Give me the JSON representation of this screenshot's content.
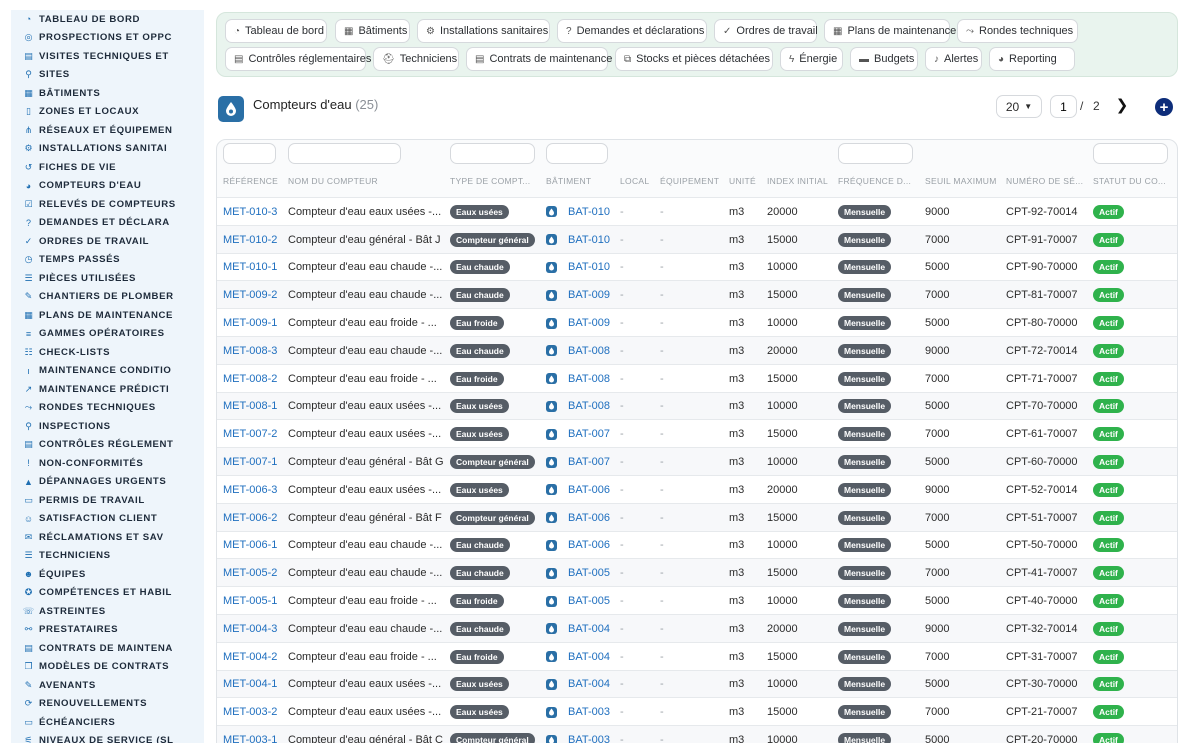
{
  "sidebar": {
    "items": [
      {
        "label": "TABLEAU DE BORD",
        "icon": "dashboard-icon"
      },
      {
        "label": "PROSPECTIONS ET OPPC",
        "icon": "target-icon"
      },
      {
        "label": "VISITES TECHNIQUES ET",
        "icon": "clipboard-icon"
      },
      {
        "label": "SITES",
        "icon": "map-pin-icon"
      },
      {
        "label": "BÂTIMENTS",
        "icon": "building-icon"
      },
      {
        "label": "ZONES ET LOCAUX",
        "icon": "door-icon"
      },
      {
        "label": "RÉSEAUX ET ÉQUIPEMEN",
        "icon": "network-icon"
      },
      {
        "label": "INSTALLATIONS SANITAI",
        "icon": "gears-icon"
      },
      {
        "label": "FICHES DE VIE",
        "icon": "history-icon"
      },
      {
        "label": "COMPTEURS D'EAU",
        "icon": "gauge-icon"
      },
      {
        "label": "RELEVÉS DE COMPTEURS",
        "icon": "check-square-icon"
      },
      {
        "label": "DEMANDES ET DÉCLARA",
        "icon": "question-icon"
      },
      {
        "label": "ORDRES DE TRAVAIL",
        "icon": "clipboard-check-icon"
      },
      {
        "label": "TEMPS PASSÉS",
        "icon": "clock-icon"
      },
      {
        "label": "PIÈCES UTILISÉES",
        "icon": "list-icon"
      },
      {
        "label": "CHANTIERS DE PLOMBER",
        "icon": "wrench-icon"
      },
      {
        "label": "PLANS DE MAINTENANCE",
        "icon": "calendar-icon"
      },
      {
        "label": "GAMMES OPÉRATOIRES",
        "icon": "layers-icon"
      },
      {
        "label": "CHECK-LISTS",
        "icon": "checklist-icon"
      },
      {
        "label": "MAINTENANCE CONDITIO",
        "icon": "thermometer-icon"
      },
      {
        "label": "MAINTENANCE PRÉDICTI",
        "icon": "chart-icon"
      },
      {
        "label": "RONDES TECHNIQUES",
        "icon": "route-icon"
      },
      {
        "label": "INSPECTIONS",
        "icon": "magnifier-icon"
      },
      {
        "label": "CONTRÔLES RÉGLEMENT",
        "icon": "clipboard-list-icon"
      },
      {
        "label": "NON-CONFORMITÉS",
        "icon": "alert-circle-icon"
      },
      {
        "label": "DÉPANNAGES URGENTS",
        "icon": "warning-triangle-icon"
      },
      {
        "label": "PERMIS DE TRAVAIL",
        "icon": "file-icon"
      },
      {
        "label": "SATISFACTION CLIENT",
        "icon": "smile-icon"
      },
      {
        "label": "RÉCLAMATIONS ET SAV",
        "icon": "comment-icon"
      },
      {
        "label": "TECHNICIENS",
        "icon": "list-icon"
      },
      {
        "label": "ÉQUIPES",
        "icon": "users-icon"
      },
      {
        "label": "COMPÉTENCES ET HABIL",
        "icon": "certificate-icon"
      },
      {
        "label": "ASTREINTES",
        "icon": "phone-icon"
      },
      {
        "label": "PRESTATAIRES",
        "icon": "handshake-icon"
      },
      {
        "label": "CONTRATS DE MAINTENA",
        "icon": "file-contract-icon"
      },
      {
        "label": "MODÈLES DE CONTRATS",
        "icon": "copy-icon"
      },
      {
        "label": "AVENANTS",
        "icon": "edit-icon"
      },
      {
        "label": "RENOUVELLEMENTS",
        "icon": "refresh-icon"
      },
      {
        "label": "ÉCHÉANCIERS",
        "icon": "file-alt-icon"
      },
      {
        "label": "NIVEAUX DE SERVICE (SL",
        "icon": "sliders-icon"
      }
    ]
  },
  "topnav": {
    "row1": [
      {
        "label": "Tableau de bord",
        "icon": "dashboard-icon"
      },
      {
        "label": "Bâtiments",
        "icon": "building-icon"
      },
      {
        "label": "Installations sanitaires",
        "icon": "gears-icon"
      },
      {
        "label": "Demandes et déclarations",
        "icon": "question-icon"
      },
      {
        "label": "Ordres de travail",
        "icon": "clipboard-check-icon"
      },
      {
        "label": "Plans de maintenance",
        "icon": "calendar-icon"
      },
      {
        "label": "Rondes techniques",
        "icon": "route-icon"
      }
    ],
    "row2": [
      {
        "label": "Contrôles réglementaires",
        "icon": "clipboard-list-icon"
      },
      {
        "label": "Techniciens",
        "icon": "hard-hat-icon"
      },
      {
        "label": "Contrats de maintenance",
        "icon": "file-contract-icon"
      },
      {
        "label": "Stocks et pièces détachées",
        "icon": "boxes-icon"
      },
      {
        "label": "Énergie",
        "icon": "bolt-icon"
      },
      {
        "label": "Budgets",
        "icon": "money-icon"
      },
      {
        "label": "Alertes",
        "icon": "bell-icon"
      },
      {
        "label": "Reporting",
        "icon": "pie-chart-icon"
      }
    ]
  },
  "header": {
    "title": "Compteurs d'eau",
    "count": "(25)"
  },
  "pagination": {
    "per_page": "20",
    "current_page": "1",
    "separator": "/",
    "total_pages": "2"
  },
  "table": {
    "columns": [
      "RÉFÉRENCE",
      "NOM DU COMPTEUR",
      "TYPE DE COMPT...",
      "BÂTIMENT",
      "LOCAL",
      "ÉQUIPEMENT",
      "UNITÉ",
      "INDEX INITIAL",
      "FRÉQUENCE D...",
      "SEUIL MAXIMUM",
      "NUMÉRO DE SÉ...",
      "STATUT DU CO..."
    ],
    "rows": [
      {
        "ref": "MET-010-3",
        "name": "Compteur d'eau eaux usées -...",
        "type": "Eaux usées",
        "bat": "BAT-010",
        "local": "-",
        "equip": "-",
        "unit": "m3",
        "index": "20000",
        "freq": "Mensuelle",
        "seuil": "9000",
        "serial": "CPT-92-70014",
        "status": "Actif"
      },
      {
        "ref": "MET-010-2",
        "name": "Compteur d'eau général - Bât J",
        "type": "Compteur général",
        "bat": "BAT-010",
        "local": "-",
        "equip": "-",
        "unit": "m3",
        "index": "15000",
        "freq": "Mensuelle",
        "seuil": "7000",
        "serial": "CPT-91-70007",
        "status": "Actif"
      },
      {
        "ref": "MET-010-1",
        "name": "Compteur d'eau eau chaude -...",
        "type": "Eau chaude",
        "bat": "BAT-010",
        "local": "-",
        "equip": "-",
        "unit": "m3",
        "index": "10000",
        "freq": "Mensuelle",
        "seuil": "5000",
        "serial": "CPT-90-70000",
        "status": "Actif"
      },
      {
        "ref": "MET-009-2",
        "name": "Compteur d'eau eau chaude -...",
        "type": "Eau chaude",
        "bat": "BAT-009",
        "local": "-",
        "equip": "-",
        "unit": "m3",
        "index": "15000",
        "freq": "Mensuelle",
        "seuil": "7000",
        "serial": "CPT-81-70007",
        "status": "Actif"
      },
      {
        "ref": "MET-009-1",
        "name": "Compteur d'eau eau froide - ...",
        "type": "Eau froide",
        "bat": "BAT-009",
        "local": "-",
        "equip": "-",
        "unit": "m3",
        "index": "10000",
        "freq": "Mensuelle",
        "seuil": "5000",
        "serial": "CPT-80-70000",
        "status": "Actif"
      },
      {
        "ref": "MET-008-3",
        "name": "Compteur d'eau eau chaude -...",
        "type": "Eau chaude",
        "bat": "BAT-008",
        "local": "-",
        "equip": "-",
        "unit": "m3",
        "index": "20000",
        "freq": "Mensuelle",
        "seuil": "9000",
        "serial": "CPT-72-70014",
        "status": "Actif"
      },
      {
        "ref": "MET-008-2",
        "name": "Compteur d'eau eau froide - ...",
        "type": "Eau froide",
        "bat": "BAT-008",
        "local": "-",
        "equip": "-",
        "unit": "m3",
        "index": "15000",
        "freq": "Mensuelle",
        "seuil": "7000",
        "serial": "CPT-71-70007",
        "status": "Actif"
      },
      {
        "ref": "MET-008-1",
        "name": "Compteur d'eau eaux usées -...",
        "type": "Eaux usées",
        "bat": "BAT-008",
        "local": "-",
        "equip": "-",
        "unit": "m3",
        "index": "10000",
        "freq": "Mensuelle",
        "seuil": "5000",
        "serial": "CPT-70-70000",
        "status": "Actif"
      },
      {
        "ref": "MET-007-2",
        "name": "Compteur d'eau eaux usées -...",
        "type": "Eaux usées",
        "bat": "BAT-007",
        "local": "-",
        "equip": "-",
        "unit": "m3",
        "index": "15000",
        "freq": "Mensuelle",
        "seuil": "7000",
        "serial": "CPT-61-70007",
        "status": "Actif"
      },
      {
        "ref": "MET-007-1",
        "name": "Compteur d'eau général - Bât G",
        "type": "Compteur général",
        "bat": "BAT-007",
        "local": "-",
        "equip": "-",
        "unit": "m3",
        "index": "10000",
        "freq": "Mensuelle",
        "seuil": "5000",
        "serial": "CPT-60-70000",
        "status": "Actif"
      },
      {
        "ref": "MET-006-3",
        "name": "Compteur d'eau eaux usées -...",
        "type": "Eaux usées",
        "bat": "BAT-006",
        "local": "-",
        "equip": "-",
        "unit": "m3",
        "index": "20000",
        "freq": "Mensuelle",
        "seuil": "9000",
        "serial": "CPT-52-70014",
        "status": "Actif"
      },
      {
        "ref": "MET-006-2",
        "name": "Compteur d'eau général - Bât F",
        "type": "Compteur général",
        "bat": "BAT-006",
        "local": "-",
        "equip": "-",
        "unit": "m3",
        "index": "15000",
        "freq": "Mensuelle",
        "seuil": "7000",
        "serial": "CPT-51-70007",
        "status": "Actif"
      },
      {
        "ref": "MET-006-1",
        "name": "Compteur d'eau eau chaude -...",
        "type": "Eau chaude",
        "bat": "BAT-006",
        "local": "-",
        "equip": "-",
        "unit": "m3",
        "index": "10000",
        "freq": "Mensuelle",
        "seuil": "5000",
        "serial": "CPT-50-70000",
        "status": "Actif"
      },
      {
        "ref": "MET-005-2",
        "name": "Compteur d'eau eau chaude -...",
        "type": "Eau chaude",
        "bat": "BAT-005",
        "local": "-",
        "equip": "-",
        "unit": "m3",
        "index": "15000",
        "freq": "Mensuelle",
        "seuil": "7000",
        "serial": "CPT-41-70007",
        "status": "Actif"
      },
      {
        "ref": "MET-005-1",
        "name": "Compteur d'eau eau froide - ...",
        "type": "Eau froide",
        "bat": "BAT-005",
        "local": "-",
        "equip": "-",
        "unit": "m3",
        "index": "10000",
        "freq": "Mensuelle",
        "seuil": "5000",
        "serial": "CPT-40-70000",
        "status": "Actif"
      },
      {
        "ref": "MET-004-3",
        "name": "Compteur d'eau eau chaude -...",
        "type": "Eau chaude",
        "bat": "BAT-004",
        "local": "-",
        "equip": "-",
        "unit": "m3",
        "index": "20000",
        "freq": "Mensuelle",
        "seuil": "9000",
        "serial": "CPT-32-70014",
        "status": "Actif"
      },
      {
        "ref": "MET-004-2",
        "name": "Compteur d'eau eau froide - ...",
        "type": "Eau froide",
        "bat": "BAT-004",
        "local": "-",
        "equip": "-",
        "unit": "m3",
        "index": "15000",
        "freq": "Mensuelle",
        "seuil": "7000",
        "serial": "CPT-31-70007",
        "status": "Actif"
      },
      {
        "ref": "MET-004-1",
        "name": "Compteur d'eau eaux usées -...",
        "type": "Eaux usées",
        "bat": "BAT-004",
        "local": "-",
        "equip": "-",
        "unit": "m3",
        "index": "10000",
        "freq": "Mensuelle",
        "seuil": "5000",
        "serial": "CPT-30-70000",
        "status": "Actif"
      },
      {
        "ref": "MET-003-2",
        "name": "Compteur d'eau eaux usées -...",
        "type": "Eaux usées",
        "bat": "BAT-003",
        "local": "-",
        "equip": "-",
        "unit": "m3",
        "index": "15000",
        "freq": "Mensuelle",
        "seuil": "7000",
        "serial": "CPT-21-70007",
        "status": "Actif"
      },
      {
        "ref": "MET-003-1",
        "name": "Compteur d'eau général - Bât C",
        "type": "Compteur général",
        "bat": "BAT-003",
        "local": "-",
        "equip": "-",
        "unit": "m3",
        "index": "10000",
        "freq": "Mensuelle",
        "seuil": "5000",
        "serial": "CPT-20-70000",
        "status": "Actif"
      }
    ]
  },
  "colors": {
    "accent": "#1f6fbf",
    "sidebar_bg": "#eef5fb",
    "nav_bg": "#e9f4ee",
    "badge_dark": "#565d66",
    "badge_active": "#2fb24c",
    "add_button": "#0d2d7a"
  }
}
